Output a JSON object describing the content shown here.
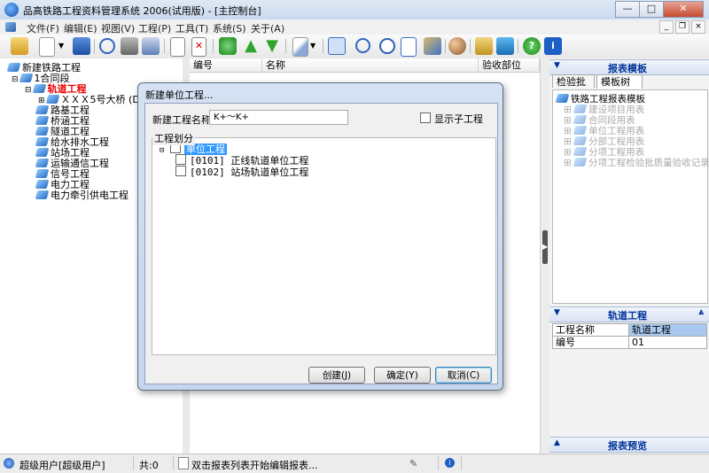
{
  "window": {
    "title": "品高铁路工程资料管理系统 2006(试用版) - [主控制台]",
    "min": "—",
    "max": "□",
    "close": "✕"
  },
  "menu": [
    "文件(F)",
    "编辑(E)",
    "视图(V)",
    "工程(P)",
    "工具(T)",
    "系统(S)",
    "关于(A)"
  ],
  "mdi": [
    "_",
    "❐",
    "×"
  ],
  "left_tree": [
    {
      "label": "新建铁路工程"
    },
    {
      "label": "1合同段"
    },
    {
      "label": "轨道工程",
      "selected": true
    },
    {
      "label": "ＸＸＸ5号大桥 (DK1("
    },
    {
      "label": "路基工程"
    },
    {
      "label": "桥涵工程"
    },
    {
      "label": "隧道工程"
    },
    {
      "label": "给水排水工程"
    },
    {
      "label": "站场工程"
    },
    {
      "label": "运输通信工程"
    },
    {
      "label": "信号工程"
    },
    {
      "label": "电力工程"
    },
    {
      "label": "电力牵引供电工程"
    }
  ],
  "center": {
    "columns": [
      "编号",
      "名称",
      "验收部位"
    ]
  },
  "right": {
    "top_header": "报表模板",
    "tabs": [
      "检验批",
      "模板树"
    ],
    "tree_root": "铁路工程报表模板",
    "tree_items": [
      "建设项目用表",
      "合同段用表",
      "单位工程用表",
      "分部工程用表",
      "分项工程用表",
      "分项工程检验批质量验收记录"
    ],
    "props_header": "轨道工程",
    "props": [
      {
        "key": "工程名称",
        "value": "轨道工程"
      },
      {
        "key": "编号",
        "value": "01"
      }
    ],
    "bottom_header": "报表预览"
  },
  "status": {
    "user": "超级用户[超级用户]",
    "count": "共:0",
    "hint": "双击报表列表开始编辑报表..."
  },
  "dialog": {
    "title": "新建单位工程...",
    "name_label": "新建工程名称:",
    "name_value": "K+～K+",
    "show_sub_label": "显示子工程",
    "group_label": "工程划分",
    "tree_root": "单位工程",
    "tree_items": [
      "[0101] 正线轨道单位工程",
      "[0102] 站场轨道单位工程"
    ],
    "btn_create": "创建(J)",
    "btn_ok": "确定(Y)",
    "btn_cancel": "取消(C)"
  }
}
